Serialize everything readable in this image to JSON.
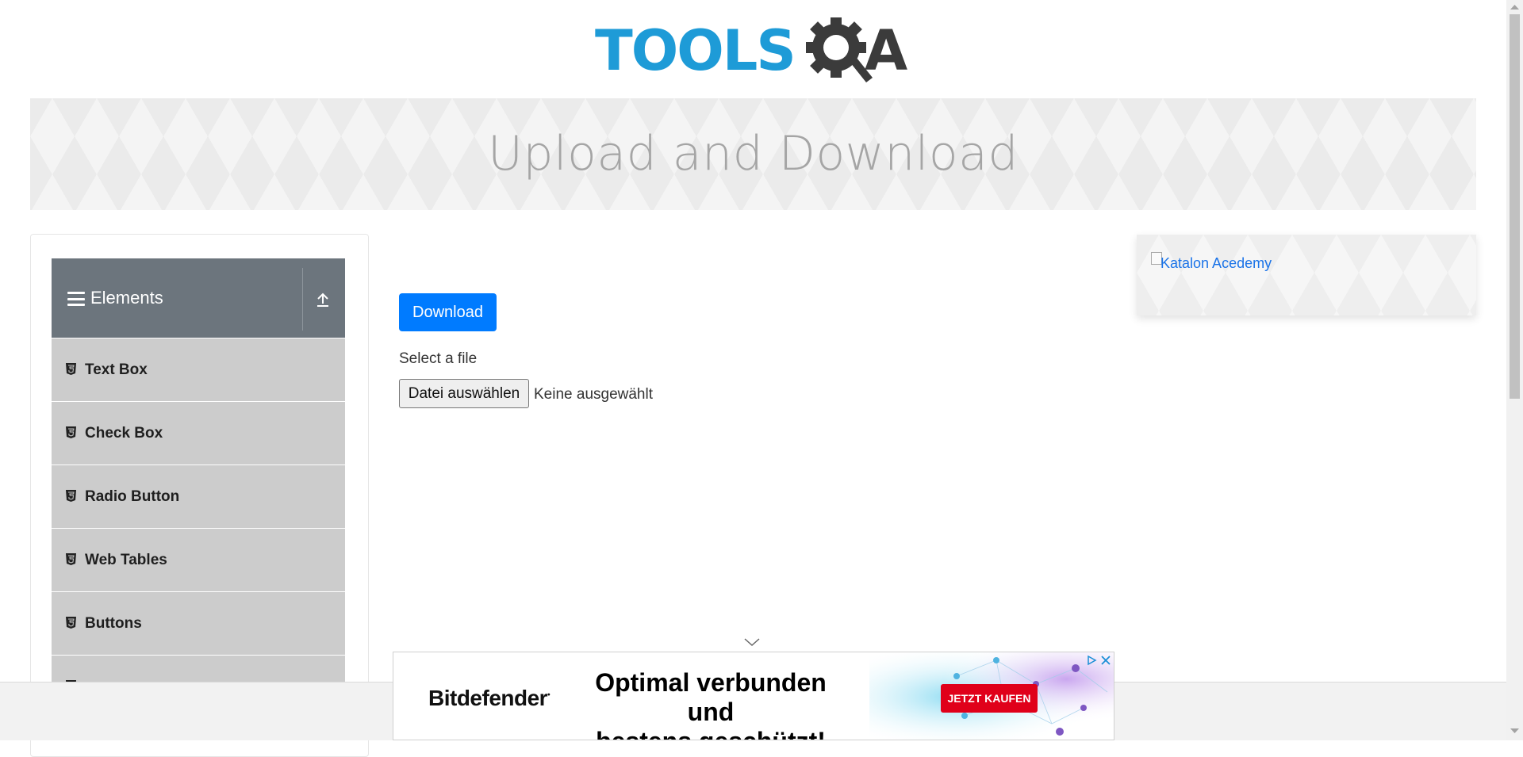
{
  "header": {
    "logo_text_left": "TOOLS",
    "logo_text_right": "A",
    "logo_colors": {
      "blue": "#1e9bd7",
      "dark": "#3b3b3b"
    }
  },
  "banner": {
    "title": "Upload and Download"
  },
  "sidebar": {
    "group_title": "Elements",
    "group_icon": "menu-icon",
    "collapse_icon": "upload-arrow-icon",
    "items": [
      {
        "label": "Text Box",
        "icon": "html5-icon"
      },
      {
        "label": "Check Box",
        "icon": "html5-icon"
      },
      {
        "label": "Radio Button",
        "icon": "html5-icon"
      },
      {
        "label": "Web Tables",
        "icon": "html5-icon"
      },
      {
        "label": "Buttons",
        "icon": "html5-icon"
      }
    ]
  },
  "main": {
    "download_label": "Download",
    "select_label": "Select a file",
    "file_button_label": "Datei auswählen",
    "file_status": "Keine ausgewählt",
    "accent": "#007bff"
  },
  "ad_right": {
    "alt_text": "Katalon Acedemy"
  },
  "ad_bottom": {
    "brand": "Bitdefender",
    "headline_line1": "Optimal verbunden und",
    "headline_line2": "bestens geschützt!",
    "cta": "JETZT KAUFEN",
    "cta_color": "#e0001a"
  }
}
